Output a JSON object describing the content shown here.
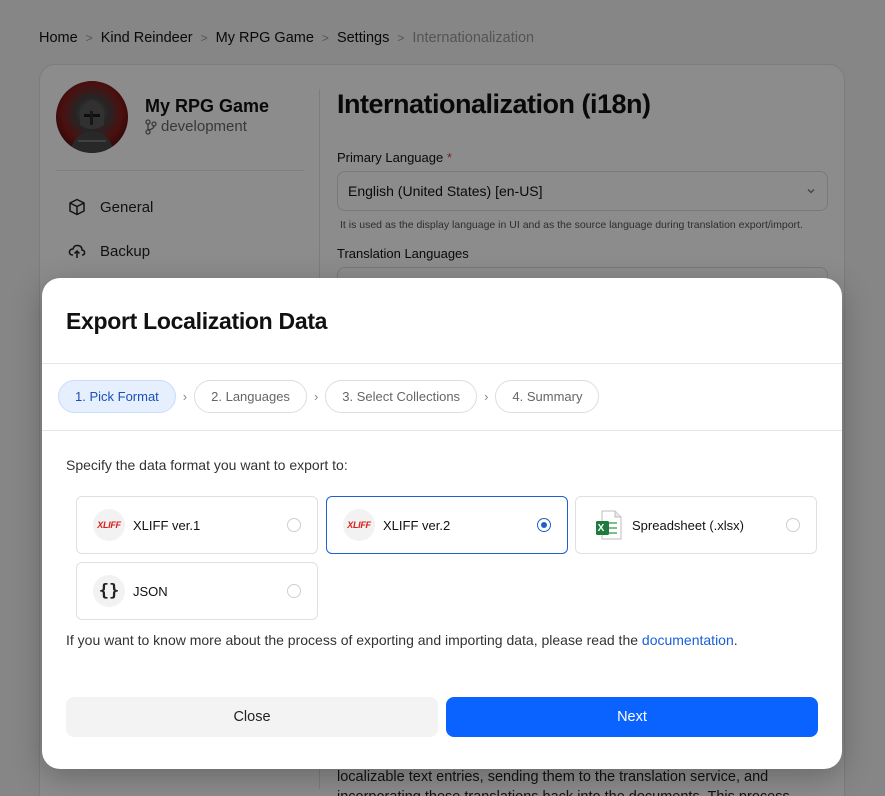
{
  "breadcrumb": {
    "items": [
      "Home",
      "Kind Reindeer",
      "My RPG Game",
      "Settings",
      "Internationalization"
    ],
    "separator": ">"
  },
  "project": {
    "name": "My RPG Game",
    "branch": "development"
  },
  "sidebar": {
    "items": [
      {
        "label": "General",
        "icon": "cube-icon"
      },
      {
        "label": "Backup",
        "icon": "cloud-upload-icon"
      }
    ]
  },
  "settings": {
    "title": "Internationalization (i18n)",
    "primary_language_label": "Primary Language",
    "required_mark": "*",
    "primary_language_value": "English (United States) [en-US]",
    "primary_language_hint": "It is used as the display language in UI and as the source language during translation export/import.",
    "translation_languages_label": "Translation Languages",
    "bottom_text": "localizable text entries, sending them to the translation service, and incorporating these translations back into the documents. This process"
  },
  "modal": {
    "title": "Export Localization Data",
    "steps": [
      {
        "label": "1. Pick Format",
        "active": true
      },
      {
        "label": "2. Languages",
        "active": false
      },
      {
        "label": "3. Select Collections",
        "active": false
      },
      {
        "label": "4. Summary",
        "active": false
      }
    ],
    "prompt": "Specify the data format you want to export to:",
    "formats": [
      {
        "label": "XLIFF ver.1",
        "icon": "xliff-icon",
        "icon_text": "XLIFF",
        "selected": false
      },
      {
        "label": "XLIFF ver.2",
        "icon": "xliff-icon",
        "icon_text": "XLIFF",
        "selected": true
      },
      {
        "label": "Spreadsheet (.xlsx)",
        "icon": "excel-icon",
        "icon_text": "X",
        "selected": false
      },
      {
        "label": "JSON",
        "icon": "json-braces-icon",
        "icon_text": "{}",
        "selected": false
      }
    ],
    "doc_text": "If you want to know more about the process of exporting and importing data, please read the ",
    "doc_link": "documentation",
    "doc_end": ".",
    "close_label": "Close",
    "next_label": "Next"
  },
  "colors": {
    "accent": "#0b63ff",
    "step_active_bg": "#e6effd",
    "required": "#e23b3b"
  }
}
